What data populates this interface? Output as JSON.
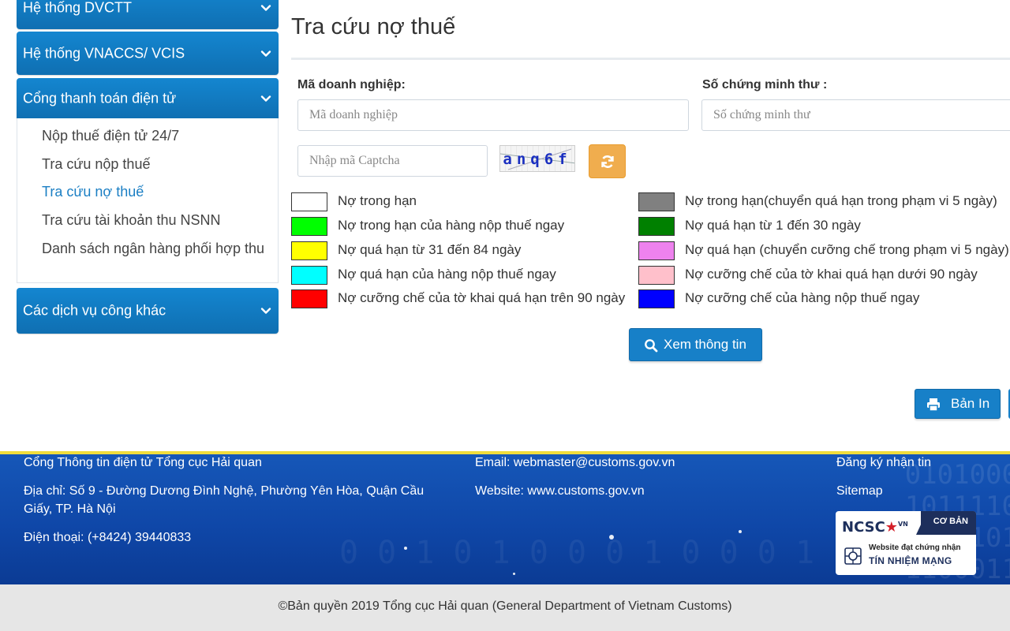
{
  "sidebar": {
    "groups": [
      {
        "label": "Hệ thống DVCTT"
      },
      {
        "label": "Hệ thống VNACCS/ VCIS"
      },
      {
        "label": "Cổng thanh toán điện tử"
      },
      {
        "label": "Các dịch vụ công khác"
      }
    ],
    "sub_items": [
      {
        "label": "Nộp thuế điện tử 24/7"
      },
      {
        "label": "Tra cứu nộp thuế"
      },
      {
        "label": "Tra cứu nợ thuế",
        "active": true
      },
      {
        "label": "Tra cứu tài khoản thu NSNN"
      },
      {
        "label": "Danh sách ngân hàng phối hợp thu"
      }
    ]
  },
  "main": {
    "title": "Tra cứu nợ thuế",
    "form": {
      "company_label": "Mã doanh nghiệp:",
      "company_placeholder": "Mã doanh nghiệp",
      "company_value": "",
      "id_label": "Số chứng minh thư :",
      "id_placeholder": "Số chứng minh thư",
      "id_value": "",
      "captcha_placeholder": "Nhập mã Captcha",
      "captcha_value": "",
      "captcha_code": "anq6f"
    },
    "legend": [
      {
        "color": "#ffffff",
        "label": "Nợ trong hạn"
      },
      {
        "color": "#808080",
        "label": "Nợ trong hạn(chuyển quá hạn trong phạm vi 5 ngày)"
      },
      {
        "color": "#00ff00",
        "label": "Nợ trong hạn của hàng nộp thuế ngay"
      },
      {
        "color": "#008000",
        "label": "Nợ quá hạn từ 1 đến 30 ngày"
      },
      {
        "color": "#ffff00",
        "label": "Nợ quá hạn từ 31 đến 84 ngày"
      },
      {
        "color": "#ee82ee",
        "label": "Nợ quá hạn (chuyển cưỡng chế trong phạm vi 5 ngày)"
      },
      {
        "color": "#00ffff",
        "label": "Nợ quá hạn của hàng nộp thuế ngay"
      },
      {
        "color": "#ffc0cb",
        "label": "Nợ cưỡng chế của tờ khai quá hạn dưới 90 ngày"
      },
      {
        "color": "#ff0000",
        "label": "Nợ cưỡng chế của tờ khai quá hạn trên 90 ngày"
      },
      {
        "color": "#0000ff",
        "label": "Nợ cưỡng chế của hàng nộp thuế ngay"
      }
    ],
    "view_button": "Xem thông tin",
    "print_button": "Bản In"
  },
  "footer": {
    "org": "Cổng Thông tin điện tử Tổng cục Hải quan",
    "address": "Địa chỉ: Số 9 - Đường Dương Đình Nghệ, Phường Yên Hòa, Quận Cầu Giấy, TP. Hà Nội",
    "phone": "Điện thoại: (+8424) 39440833",
    "email": "Email: webmaster@customs.gov.vn",
    "website": "Website: www.customs.gov.vn",
    "subscribe": "Đăng ký nhận tin",
    "sitemap": "Sitemap",
    "badge": {
      "logo": "NCSC",
      "logo_sup": "VN",
      "level": "CƠ BẢN",
      "line1": "Website đạt chứng nhận",
      "line2": "TÍN NHIỆM MẠNG"
    },
    "copyright": "©Bản quyền 2019 Tổng cục Hải quan (General Department of Vietnam Customs)"
  },
  "colors": {
    "nav_blue": "#1486d0",
    "link_active": "#1b7fc4",
    "refresh_orange": "#f0ad4e",
    "footer_blue": "#1657b8",
    "footer_border": "#f1dd3c"
  },
  "icons": [
    "chevron-down-icon",
    "refresh-icon",
    "search-icon",
    "print-icon",
    "gear-icon"
  ]
}
